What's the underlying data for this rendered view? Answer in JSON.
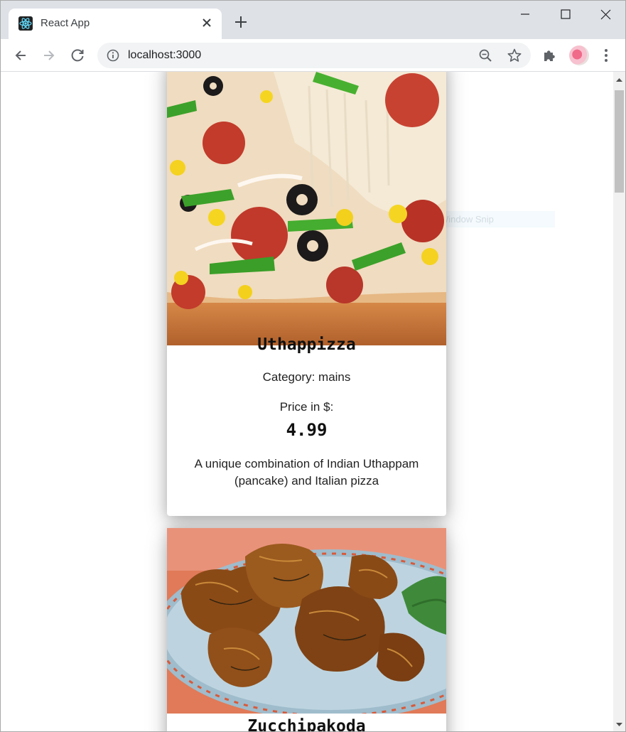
{
  "browser": {
    "tab_title": "React App",
    "tab_favicon": "react-logo-icon",
    "address": "localhost:3000",
    "icons": {
      "back": "back-arrow-icon",
      "forward": "forward-arrow-icon",
      "reload": "reload-icon",
      "info": "info-icon",
      "zoom": "zoom-out-icon",
      "bookmark": "star-icon",
      "extensions": "puzzle-icon",
      "menu": "kebab-menu-icon"
    }
  },
  "overlay": {
    "snip_label": "Window Snip"
  },
  "dishes": [
    {
      "name": "Uthappizza",
      "image": "pizza-photo",
      "category_label": "Category: mains",
      "price_label": "Price in $:",
      "price": "4.99",
      "description": "A unique combination of Indian Uthappam (pancake) and Italian pizza"
    },
    {
      "name": "Zucchipakoda",
      "image": "pakoda-photo"
    }
  ],
  "colors": {
    "tabstrip": "#dee1e6",
    "omnibox": "#f1f3f4",
    "react_accent": "#61dafb"
  }
}
